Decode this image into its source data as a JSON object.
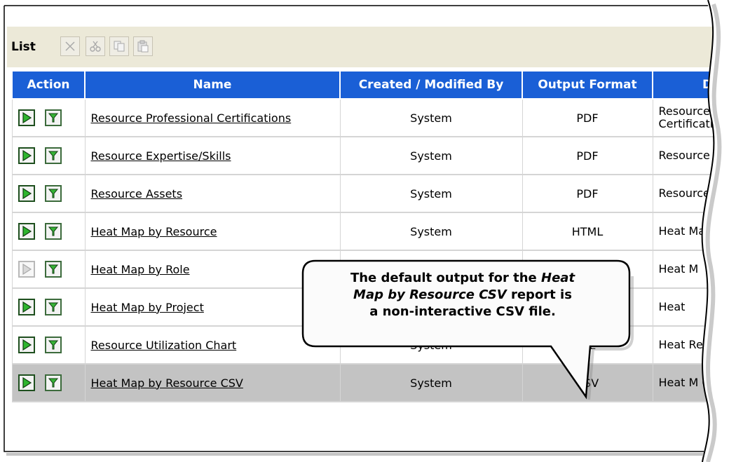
{
  "toolbar": {
    "list_label": "List",
    "buttons": [
      "close-icon",
      "cut-icon",
      "copy-icon",
      "paste-icon"
    ]
  },
  "table": {
    "columns": [
      "Action",
      "Name",
      "Created / Modified By",
      "Output Format",
      "Desc"
    ],
    "rows": [
      {
        "name": "Resource Professional Certifications",
        "created_by": "System",
        "format": "PDF",
        "desc": "Resource Pr Certifications",
        "run_enabled": true
      },
      {
        "name": "Resource Expertise/Skills",
        "created_by": "System",
        "format": "PDF",
        "desc": "Resource Ex",
        "run_enabled": true
      },
      {
        "name": "Resource Assets",
        "created_by": "System",
        "format": "PDF",
        "desc": "Resource",
        "run_enabled": true
      },
      {
        "name": "Heat Map by Resource",
        "created_by": "System",
        "format": "HTML",
        "desc": "Heat Ma",
        "run_enabled": true
      },
      {
        "name": "Heat Map by Role",
        "created_by": "",
        "format": "",
        "desc": "Heat M",
        "run_enabled": false
      },
      {
        "name": "Heat Map by Project",
        "created_by": "",
        "format": "",
        "desc": "Heat",
        "run_enabled": true
      },
      {
        "name": "Resource Utilization Chart",
        "created_by": "System",
        "format": "ML",
        "desc": "Heat Resou",
        "run_enabled": true
      },
      {
        "name": "Heat Map by Resource CSV",
        "created_by": "System",
        "format": "CSV",
        "desc": "Heat M CSV",
        "run_enabled": true,
        "selected": true
      }
    ]
  },
  "callout": {
    "line1_pre": "The default output for the ",
    "line1_em": "Heat",
    "line2_em": "Map by Resource CSV",
    "line2_post": " report is",
    "line3": "a non-interactive CSV file."
  },
  "colors": {
    "header_bg": "#1a5fd6",
    "toolbar_bg": "#ECE9D8",
    "selected_row_bg": "#c3c3c3",
    "run_icon": "#2fb52f"
  }
}
